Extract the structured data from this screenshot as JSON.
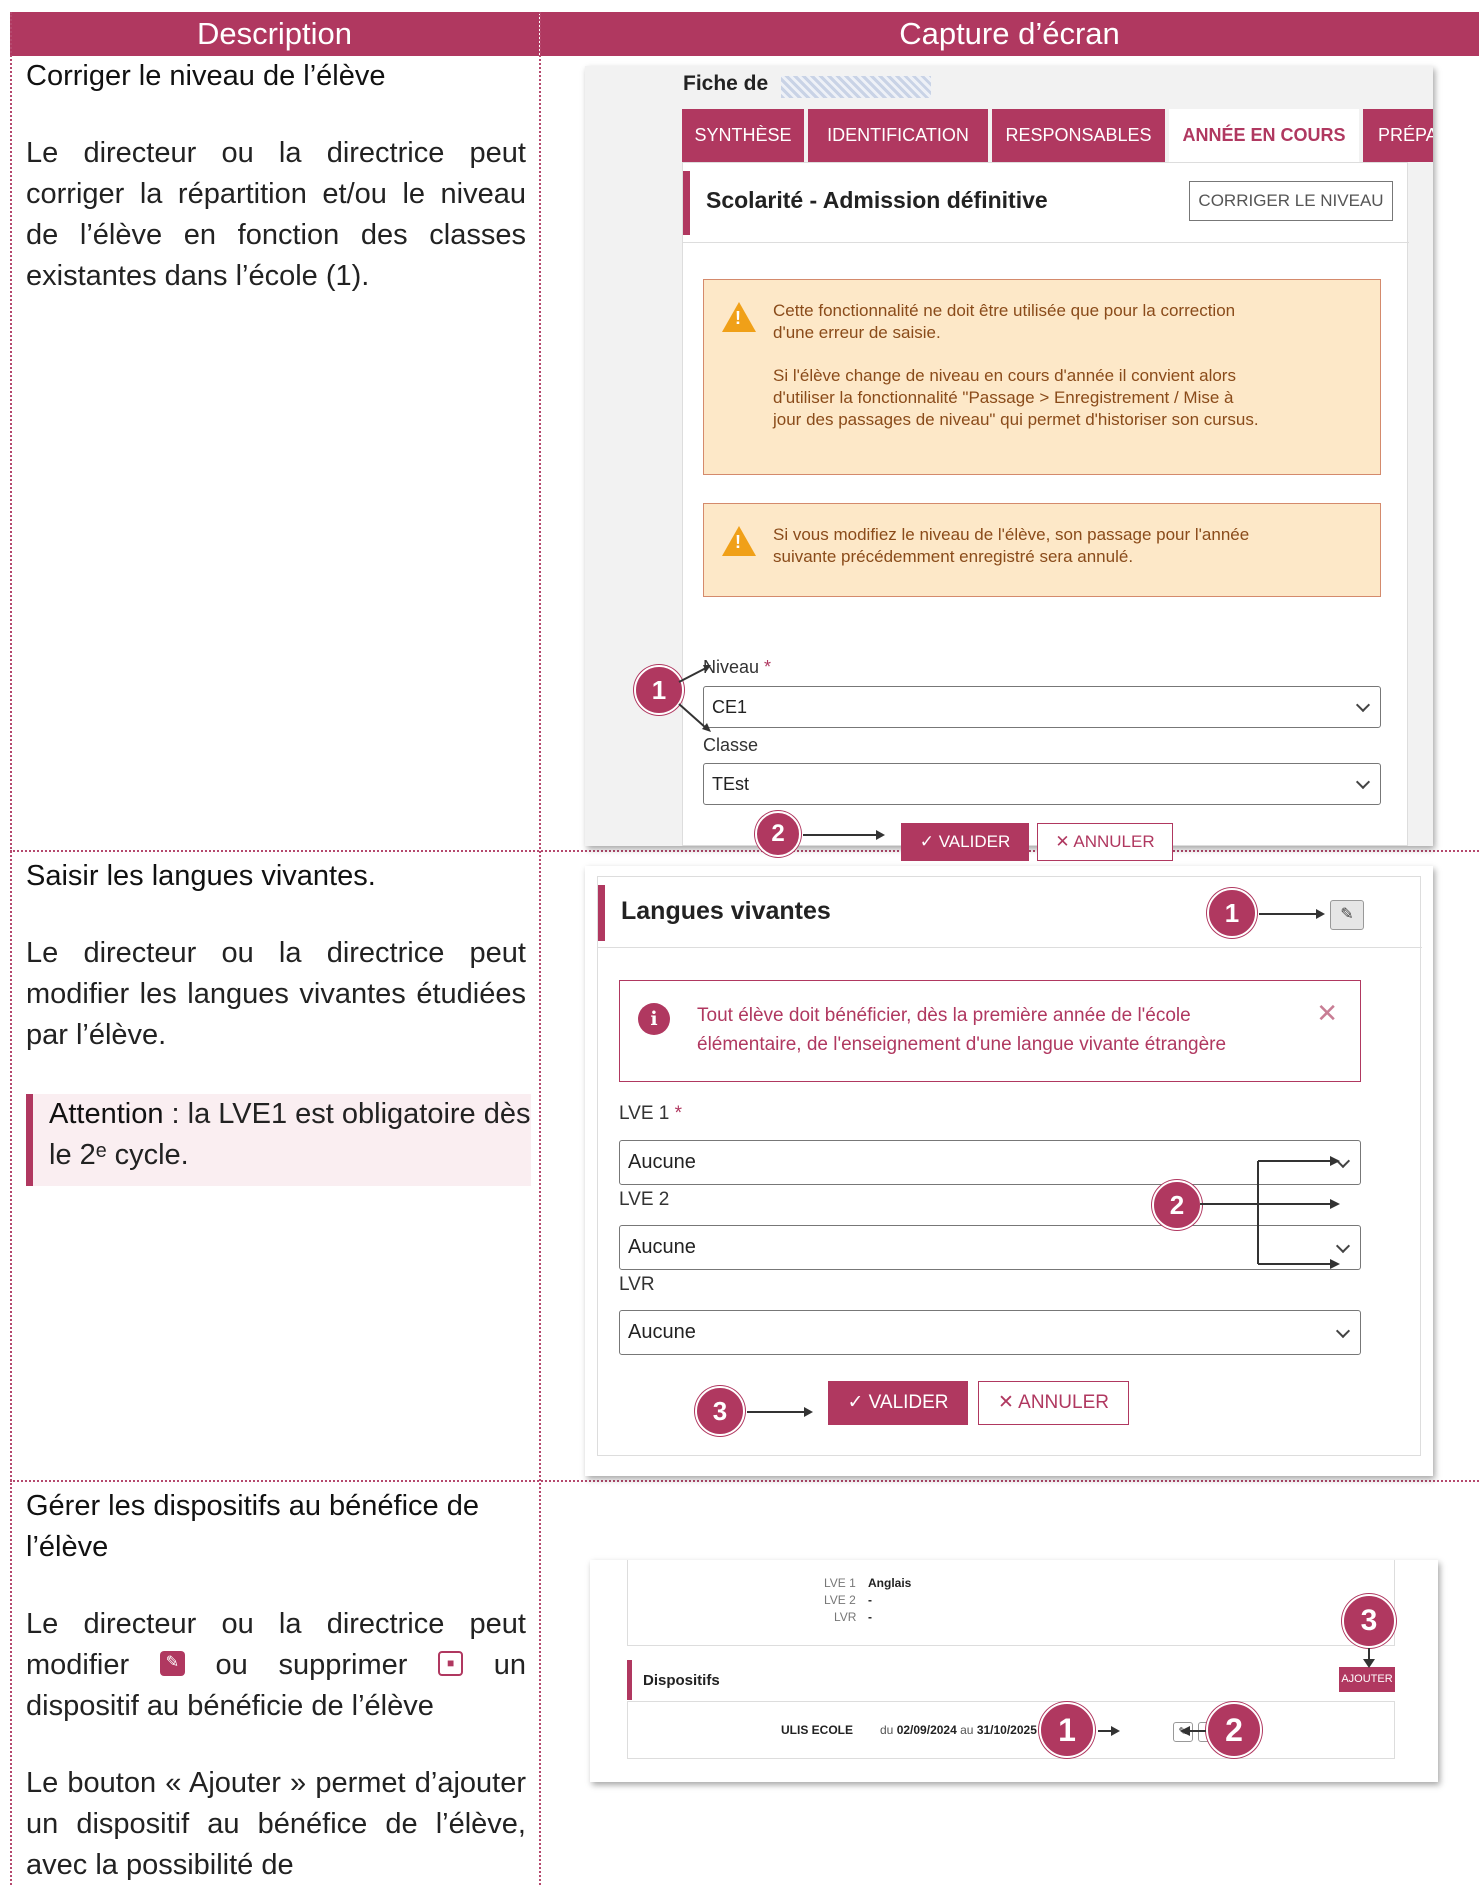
{
  "header": {
    "description": "Description",
    "capture": "Capture d’écran"
  },
  "rows": [
    {
      "title": "Corriger le niveau de l’élève",
      "paragraphs": [
        "Le directeur ou la directrice peut corriger la répartition et/ou le niveau de l’élève en fonction des classes existantes dans l’école (1)."
      ]
    },
    {
      "title": "Saisir les langues vivantes.",
      "paragraphs": [
        "Le directeur ou la directrice peut modifier les langues vivantes étudiées par l’élève."
      ],
      "note_label": "Attention",
      "note_text": " : la LVE1 est obligatoire dès le 2ᵉ cycle."
    },
    {
      "title": "Gérer les dispositifs au bénéfice de l’élève",
      "p1_a": "Le directeur ou la directrice peut modifier",
      "p1_b": "ou supprimer",
      "p1_c": "un dispositif au bénéficie de l’élève",
      "p2": "Le bouton « Ajouter » permet d’ajouter un dispositif au bénéfice de l’élève, avec la possibilité de"
    }
  ],
  "shot1": {
    "fiche": "Fiche de",
    "tabs": [
      "SYNTHÈSE",
      "IDENTIFICATION",
      "RESPONSABLES",
      "ANNÉE EN COURS",
      "PRÉPA"
    ],
    "section_title": "Scolarité - Admission définitive",
    "corriger_button": "CORRIGER LE NIVEAU",
    "warning1_line1": "Cette fonctionnalité ne doit être utilisée que pour la correction",
    "warning1_line2": "d'une erreur de saisie.",
    "warning1_line3": "Si l'élève change de niveau en cours d'année il convient alors",
    "warning1_line4": "d'utiliser la fonctionnalité \"Passage > Enregistrement / Mise à",
    "warning1_line5": "jour des passages de niveau\" qui permet d'historiser son cursus.",
    "warning2_line1": "Si vous modifiez le niveau de l'élève, son passage pour l'année",
    "warning2_line2": "suivante précédemment enregistré sera annulé.",
    "niveau_label": "Niveau",
    "niveau_value": "CE1",
    "classe_label": "Classe",
    "classe_value": "TEst",
    "valider": "✓ VALIDER",
    "annuler": "✕ ANNULER",
    "badge1": "1",
    "badge2": "2"
  },
  "shot2": {
    "section_title": "Langues vivantes",
    "info_line1": "Tout élève doit bénéficier, dès la première année de l'école",
    "info_line2": "élémentaire, de l'enseignement d'une langue vivante étrangère",
    "close": "✕",
    "lve1_label": "LVE 1",
    "lve1_value": "Aucune",
    "lve2_label": "LVE 2",
    "lve2_value": "Aucune",
    "lvr_label": "LVR",
    "lvr_value": "Aucune",
    "valider": "✓ VALIDER",
    "annuler": "✕ ANNULER",
    "badge1": "1",
    "badge2": "2",
    "badge3": "3"
  },
  "shot3": {
    "lve1_label": "LVE 1",
    "lve1_value": "Anglais",
    "lve2_label": "LVE 2",
    "lve2_value": "-",
    "lvr_label": "LVR",
    "lvr_value": "-",
    "section_title": "Dispositifs",
    "ajouter": "AJOUTER",
    "dispositif_name": "ULIS ECOLE",
    "du": "du",
    "date_start": "02/09/2024",
    "au": "au",
    "date_end": "31/10/2025",
    "badge1": "1",
    "badge2": "2",
    "badge3": "3"
  },
  "colors": {
    "accent": "#b03860",
    "warning_bg": "#fde8c8",
    "warning_icon": "#f0a018"
  },
  "icons": {
    "edit": "pencil-icon",
    "delete": "trash-icon",
    "warning": "warning-triangle-icon",
    "info": "info-icon",
    "chevron": "chevron-down-icon"
  }
}
